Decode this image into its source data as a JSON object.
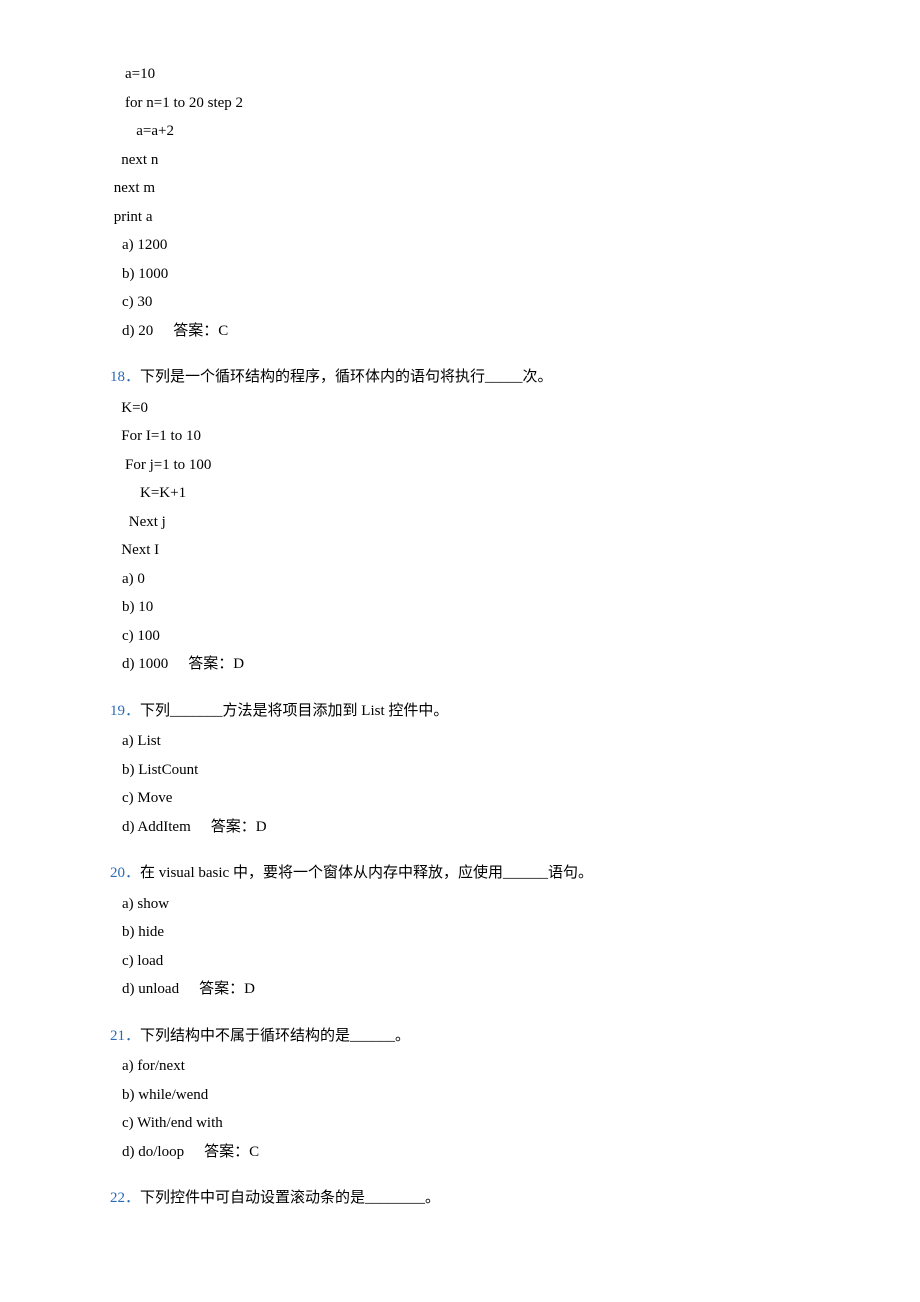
{
  "q17": {
    "code": [
      "    a=10",
      "    for n=1 to 20 step 2",
      "       a=a+2",
      "   next n",
      " next m",
      " print a"
    ],
    "options": {
      "a": "a)  1200",
      "b": "b)  1000",
      "c": "c)  30",
      "d": "d)  20"
    },
    "answer": "答案：C"
  },
  "q18": {
    "num": "18．",
    "text": "下列是一个循环结构的程序，循环体内的语句将执行_____次。",
    "code": [
      "   K=0",
      "   For I=1 to 10",
      "    For j=1 to 100",
      "        K=K+1",
      "     Next j",
      "   Next I"
    ],
    "options": {
      "a": "a)  0",
      "b": "b)  10",
      "c": "c)  100",
      "d": "d)  1000"
    },
    "answer": "答案：D"
  },
  "q19": {
    "num": "19．",
    "text_before": "下列_______方法是将项目添加到 ",
    "english_word": "List ",
    "text_after": "控件中。",
    "options": {
      "a": "a)  List",
      "b": "b)  ListCount",
      "c": "c)  Move",
      "d": "d)  AddItem"
    },
    "answer": "答案：D"
  },
  "q20": {
    "num": "20．",
    "text_before": "在 ",
    "english_word": "visual basic ",
    "text_after": "中，要将一个窗体从内存中释放，应使用______语句。",
    "options": {
      "a": "a)  show",
      "b": "b)  hide",
      "c": "c)  load",
      "d": "d)  unload"
    },
    "answer": "答案：D"
  },
  "q21": {
    "num": "21．",
    "text": "下列结构中不属于循环结构的是______。",
    "options": {
      "a": "a)  for/next",
      "b": "b)  while/wend",
      "c": "c)  With/end with",
      "d": "d)  do/loop"
    },
    "answer": "答案：C"
  },
  "q22": {
    "num": "22．",
    "text": "下列控件中可自动设置滚动条的是________。"
  }
}
